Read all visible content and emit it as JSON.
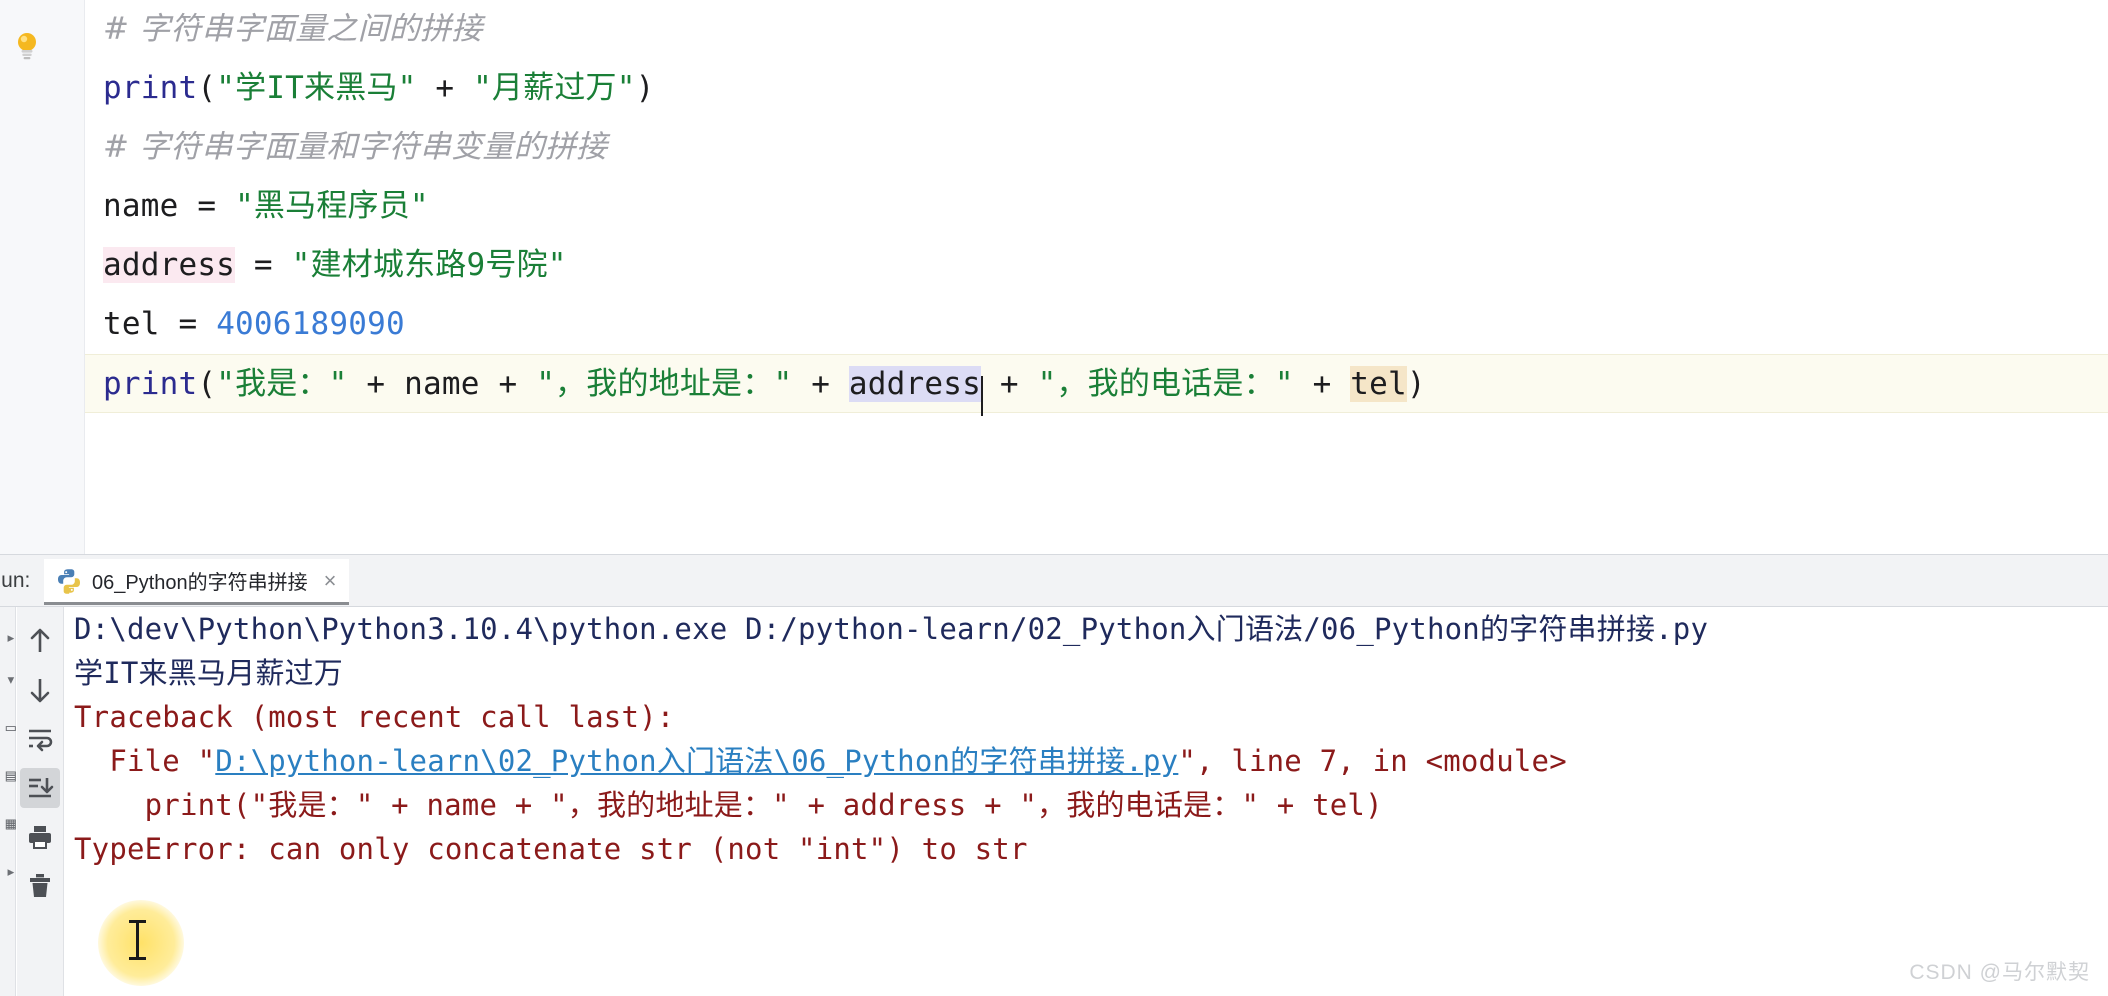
{
  "editor": {
    "lines": [
      {
        "id": "l1",
        "current": false,
        "segments": [
          {
            "text": "# ",
            "cls": "tok-comment"
          },
          {
            "text": "字符串字面量之间的拼接",
            "cls": "tok-comment"
          }
        ]
      },
      {
        "id": "l2",
        "current": false,
        "segments": [
          {
            "text": "print",
            "cls": "tok-kw"
          },
          {
            "text": "(",
            "cls": "tok-plain"
          },
          {
            "text": "\"学IT来黑马\"",
            "cls": "tok-str"
          },
          {
            "text": " + ",
            "cls": "tok-plain"
          },
          {
            "text": "\"月薪过万\"",
            "cls": "tok-str"
          },
          {
            "text": ")",
            "cls": "tok-plain"
          }
        ]
      },
      {
        "id": "l3",
        "current": false,
        "segments": [
          {
            "text": "# ",
            "cls": "tok-comment"
          },
          {
            "text": "字符串字面量和字符串变量的拼接",
            "cls": "tok-comment"
          }
        ]
      },
      {
        "id": "l4",
        "current": false,
        "segments": [
          {
            "text": "name",
            "cls": "tok-plain"
          },
          {
            "text": " = ",
            "cls": "tok-plain"
          },
          {
            "text": "\"黑马程序员\"",
            "cls": "tok-str"
          }
        ]
      },
      {
        "id": "l5",
        "current": false,
        "segments": [
          {
            "text": "address",
            "cls": "tok-plain hl-pink"
          },
          {
            "text": " = ",
            "cls": "tok-plain"
          },
          {
            "text": "\"建材城东路9号院\"",
            "cls": "tok-str"
          }
        ]
      },
      {
        "id": "l6",
        "current": false,
        "segments": [
          {
            "text": "tel",
            "cls": "tok-plain"
          },
          {
            "text": " = ",
            "cls": "tok-plain"
          },
          {
            "text": "4006189090",
            "cls": "tok-num"
          }
        ]
      },
      {
        "id": "l7",
        "current": true,
        "segments": [
          {
            "text": "print",
            "cls": "tok-kw"
          },
          {
            "text": "(",
            "cls": "tok-plain"
          },
          {
            "text": "\"我是：\"",
            "cls": "tok-str"
          },
          {
            "text": " + ",
            "cls": "tok-plain"
          },
          {
            "text": "name",
            "cls": "tok-plain"
          },
          {
            "text": " + ",
            "cls": "tok-plain"
          },
          {
            "text": "\"，我的地址是：\"",
            "cls": "tok-str"
          },
          {
            "text": " + ",
            "cls": "tok-plain"
          },
          {
            "text": "address",
            "cls": "tok-plain hl-sel caret-after"
          },
          {
            "text": " + ",
            "cls": "tok-plain"
          },
          {
            "text": "\"，我的电话是：\"",
            "cls": "tok-str"
          },
          {
            "text": " + ",
            "cls": "tok-plain"
          },
          {
            "text": "tel",
            "cls": "tok-plain hl-tan"
          },
          {
            "text": ")",
            "cls": "tok-plain"
          }
        ]
      }
    ],
    "intention_bulb": "lightbulb-icon"
  },
  "run_panel": {
    "label": "Run:",
    "tab": {
      "icon": "python-icon",
      "title": "06_Python的字符串拼接",
      "close": "×"
    },
    "toolbar": [
      {
        "name": "rerun-up-arrow",
        "icon": "arrow-up-icon",
        "active": false
      },
      {
        "name": "rerun-down-arrow",
        "icon": "arrow-down-icon",
        "active": false
      },
      {
        "name": "soft-wrap",
        "icon": "soft-wrap-icon",
        "active": false
      },
      {
        "name": "scroll-to-end",
        "icon": "scroll-to-end-icon",
        "active": true
      },
      {
        "name": "print-output",
        "icon": "printer-icon",
        "active": false
      },
      {
        "name": "clear-all",
        "icon": "trash-icon",
        "active": false
      }
    ],
    "console_lines": [
      {
        "id": "c1",
        "segments": [
          {
            "text": "D:\\dev\\Python\\Python3.10.4\\python.exe D:/python-learn/02_Python入门语法/06_Python的字符串拼接.py",
            "cls": "c-navy"
          }
        ]
      },
      {
        "id": "c2",
        "segments": [
          {
            "text": "学IT来黑马月薪过万",
            "cls": "c-navy"
          }
        ]
      },
      {
        "id": "c3",
        "segments": [
          {
            "text": "Traceback (most recent call last):",
            "cls": "c-err"
          }
        ]
      },
      {
        "id": "c4",
        "segments": [
          {
            "text": "  File \"",
            "cls": "c-err"
          },
          {
            "text": "D:\\python-learn\\02_Python入门语法\\06_Python的字符串拼接.py",
            "cls": "c-link"
          },
          {
            "text": "\", line 7, in <module>",
            "cls": "c-err"
          }
        ]
      },
      {
        "id": "c5",
        "segments": [
          {
            "text": "    print(\"我是：\" + name + \"，我的地址是：\" + address + \"，我的电话是：\" + tel)",
            "cls": "c-err"
          }
        ]
      },
      {
        "id": "c6",
        "segments": [
          {
            "text": "TypeError: can only concatenate str (not \"int\") to str",
            "cls": "c-err"
          }
        ]
      }
    ]
  },
  "watermark": "CSDN @马尔默契",
  "colors": {
    "string_green": "#1a7f37",
    "number_blue": "#3a7bd5",
    "comment_gray": "#a0a1a7",
    "error_red": "#8b1a1a",
    "console_navy": "#1f2a5c",
    "link_blue": "#2a7fc1",
    "pink_highlight": "#fbe9f0",
    "tan_highlight": "#f5e6c8",
    "selection_lavender": "#dcdcf5",
    "current_line": "#fcfbf0"
  }
}
